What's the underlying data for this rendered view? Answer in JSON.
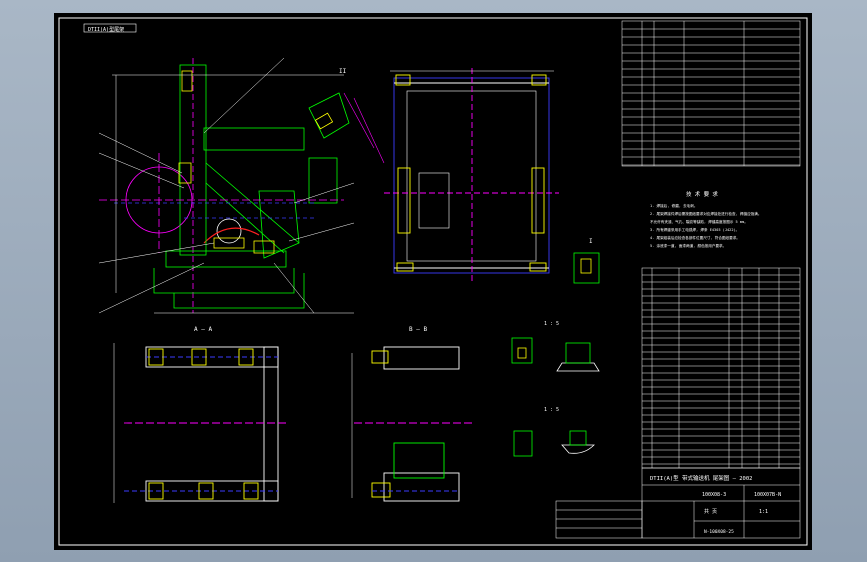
{
  "drawing": {
    "title_block": {
      "main_title": "DTII(A)型 带式输送机 尾架图 — 2002",
      "drawing_no_left": "100X08-3",
      "drawing_no_right": "100X07B-N",
      "material_label": "共 页",
      "scale_label": "1:1",
      "small_code": "N-100X08-25"
    },
    "section_labels": {
      "a_a": "A — A",
      "b_b": "B — B",
      "view_i": "I",
      "view_ii": "II",
      "scale_1_5": "1 : 5",
      "scale_1_5_b": "1 : 5"
    },
    "notes": {
      "heading": "技 术 要 求",
      "lines": [
        "1. 焊接后, 修磨, 去毛刺。",
        "2. 尾架焊接件焊后需按图纸要求对应焊接处进行检查, 焊缝应饱满。",
        "   不允许有夹渣、气孔、裂纹等缺陷, 焊缝高度按图示 5 mm。",
        "3. 所有焊缝采用手工电弧焊, 焊条 E4303 (J422)。",
        "4. 尾架组装后应检查各部件位置尺寸, 符合图纸要求。",
        "5. 涂底漆一道, 面漆两道, 颜色按用户要求。"
      ]
    },
    "top_left_label": "DTII(A)型尾架",
    "colors": {
      "sheet": "#000000",
      "frame": "#ffffff",
      "outline": "#00ff00",
      "blue": "#3c3cff",
      "magenta": "#ff00ff",
      "yellow": "#ffff00",
      "red": "#ff2020",
      "cyan": "#00ffff"
    }
  }
}
